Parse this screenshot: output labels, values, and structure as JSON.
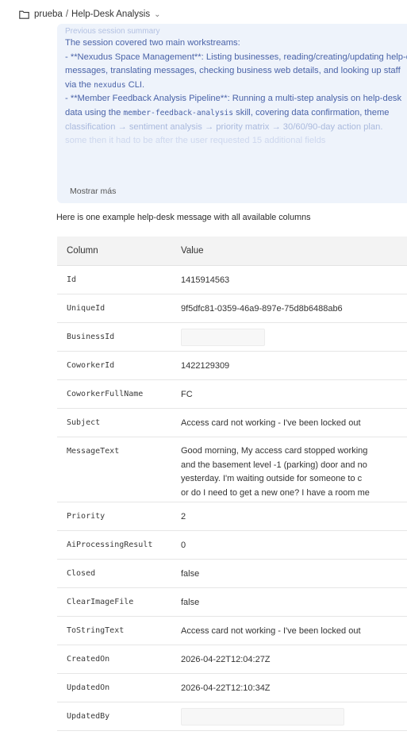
{
  "breadcrumb": {
    "project": "prueba",
    "separator": "/",
    "page": "Help-Desk Analysis",
    "chevron": "⌄"
  },
  "summary": {
    "faded_top": "Previous session summary",
    "lines": [
      "The session covered two main workstreams:",
      "- **Nexudus Space Management**: Listing businesses, reading/creating/updating help-desk",
      "messages, translating messages, checking business web details, and looking up staff"
    ],
    "line4_prefix": "via the ",
    "line4_code": "nexudus",
    "line4_suffix": " CLI.",
    "line5": "- **Member Feedback Analysis Pipeline**: Running a multi-step analysis on help-desk",
    "line6_prefix": "data using the ",
    "line6_code": "member-feedback-analysis",
    "line6_suffix": " skill, covering data confirmation, theme",
    "line7": "classification → sentiment analysis → priority matrix → 30/60/90-day action plan.",
    "line8": "some then it had to be after the user requested 15 additional fields",
    "show_more": "Mostrar más"
  },
  "intro": "Here is one example help-desk message with all available columns",
  "table": {
    "headers": [
      "Column",
      "Value"
    ],
    "rows": [
      {
        "key": "Id",
        "value": "1415914563"
      },
      {
        "key": "UniqueId",
        "value": "9f5dfc81-0359-46a9-897e-75d8b6488ab6"
      },
      {
        "key": "BusinessId",
        "value": ""
      },
      {
        "key": "CoworkerId",
        "value": "1422129309"
      },
      {
        "key": "CoworkerFullName",
        "value": "FC"
      },
      {
        "key": "Subject",
        "value": "Access card not working - I've been locked out"
      },
      {
        "key": "MessageText",
        "lines": [
          "Good morning, My access card stopped working",
          "and the basement level -1 (parking) door and no",
          "yesterday. I'm waiting outside for someone to c",
          "or do I need to get a new one? I have a room me"
        ]
      },
      {
        "key": "Priority",
        "value": "2"
      },
      {
        "key": "AiProcessingResult",
        "value": "0"
      },
      {
        "key": "Closed",
        "value": "false"
      },
      {
        "key": "ClearImageFile",
        "value": "false"
      },
      {
        "key": "ToStringText",
        "value": "Access card not working - I've been locked out"
      },
      {
        "key": "CreatedOn",
        "value": "2026-04-22T12:04:27Z"
      },
      {
        "key": "UpdatedOn",
        "value": "2026-04-22T12:10:34Z"
      },
      {
        "key": "UpdatedBy",
        "value": ""
      }
    ]
  }
}
